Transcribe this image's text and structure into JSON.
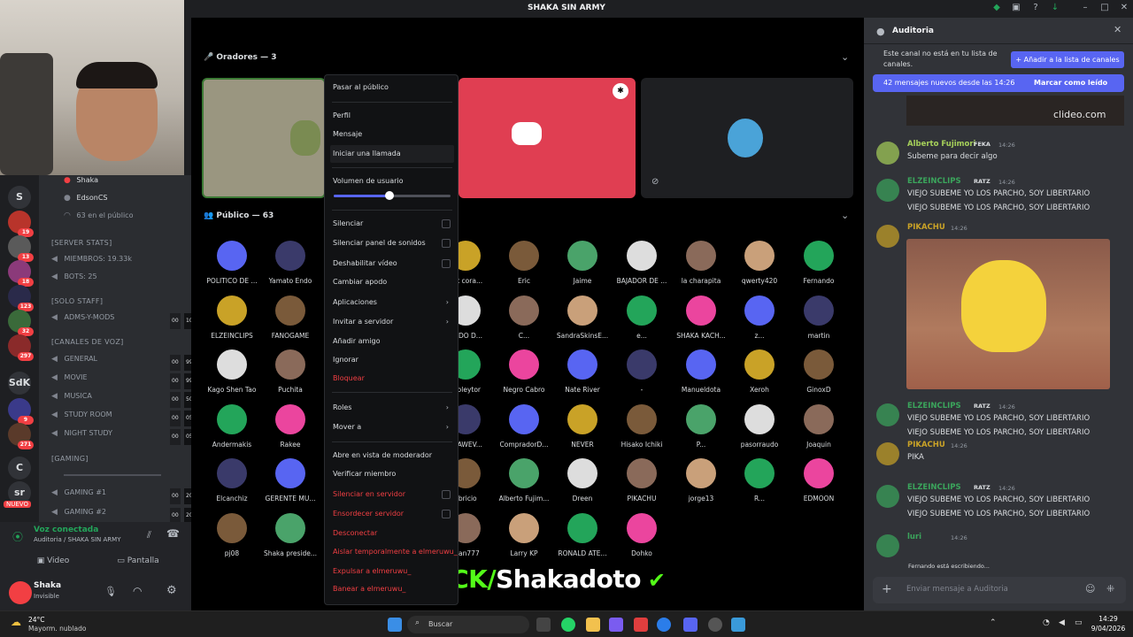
{
  "window": {
    "title": "SHAKA SIN ARMY"
  },
  "servers": [
    {
      "label": "S",
      "badge": ""
    },
    {
      "label": "",
      "badge": "19"
    },
    {
      "label": "",
      "badge": "13"
    },
    {
      "label": "",
      "badge": "18"
    },
    {
      "label": "",
      "badge": "123"
    },
    {
      "label": "",
      "badge": "32"
    },
    {
      "label": "",
      "badge": "297"
    },
    {
      "label": "SdK",
      "badge": ""
    },
    {
      "label": "",
      "badge": "9"
    },
    {
      "label": "",
      "badge": "271"
    },
    {
      "label": "C",
      "badge": ""
    },
    {
      "label": "sr",
      "badge": ""
    }
  ],
  "servers_new_badge": "NUEVO",
  "channels": {
    "voice_users": [
      "Shaka",
      "EdsonCS"
    ],
    "public_count": "63 en el público",
    "server_stats_header": "[SERVER STATS]",
    "members": "MIEMBROS: 19.33k",
    "bots": "BOTS: 25",
    "solo_staff": "[SOLO STAFF]",
    "adms": "ADMS-Y-MODS",
    "adms_c1": "00",
    "adms_c2": "10",
    "voice_header": "[CANALES DE VOZ]",
    "general": "GENERAL",
    "general_c1": "00",
    "general_c2": "99",
    "movie": "MOVIE",
    "movie_c1": "00",
    "movie_c2": "99",
    "musica": "MUSICA",
    "musica_c1": "00",
    "musica_c2": "50",
    "study": "STUDY ROOM",
    "study_c1": "00",
    "study_c2": "05",
    "night": "NIGHT STUDY",
    "night_c1": "00",
    "night_c2": "05",
    "gaming_header": "[GAMING]",
    "gaming1": "GAMING #1",
    "gaming1_c1": "00",
    "gaming1_c2": "20",
    "gaming2": "GAMING #2",
    "gaming2_c1": "00",
    "gaming2_c2": "20"
  },
  "voice_panel": {
    "status": "Voz conectada",
    "location": "Auditoria / SHAKA SIN ARMY",
    "video": "Video",
    "screen": "Pantalla"
  },
  "user_panel": {
    "name": "Shaka",
    "status": "Invisible"
  },
  "stage": {
    "speakers_header": "Oradores — 3",
    "audience_header": "Público — 63"
  },
  "audience": [
    [
      "POLITICO DE ...",
      "Yamato Endo",
      "",
      "ont cora...",
      "Eric",
      "Jaime",
      "BAJADOR DE ...",
      "la charapita",
      "qwerty420",
      "Fernando"
    ],
    [
      "ELZEINCLIPS",
      "FANOGAME",
      "",
      "GADO D...",
      "C...",
      "SandraSkinsE...",
      "e...",
      "SHAKA KACH...",
      "z...",
      "martin"
    ],
    [
      "Kago Shen Tao",
      "Puchita",
      "",
      "rgoleytor",
      "Negro Cabro",
      "Nate River",
      "-",
      "Manueldota",
      "Xeroh",
      "GinoxD"
    ],
    [
      "Andermakis",
      "Rakee",
      "",
      "ESAWEV...",
      "CompradorD...",
      "NEVER",
      "Hisako Ichiki",
      "P...",
      "pasorraudo",
      "Joaquin"
    ],
    [
      "Elcanchiz",
      "GERENTE MU...",
      "",
      "abricio",
      "Alberto Fujim...",
      "Dreen",
      "PIKACHU",
      "jorge13",
      "R...",
      "EDMOON"
    ],
    [
      "pj08",
      "Shaka preside...",
      "",
      "lfran777",
      "Larry KP",
      "RONALD ATE...",
      "Dohko",
      "",
      "",
      ""
    ]
  ],
  "overlay": {
    "kick_prefix": "KICK/",
    "kick_name": "Shakadoto"
  },
  "context_menu": {
    "items": [
      "Pasar al público",
      "Perfil",
      "Mensaje",
      "Iniciar una llamada",
      "Volumen de usuario",
      "Silenciar",
      "Silenciar panel de sonidos",
      "Deshabilitar vídeo",
      "Cambiar apodo",
      "Aplicaciones",
      "Invitar a servidor",
      "Añadir amigo",
      "Ignorar",
      "Bloquear",
      "Roles",
      "Mover a",
      "Abre en vista de moderador",
      "Verificar miembro",
      "Silenciar en servidor",
      "Ensordecer servidor",
      "Desconectar",
      "Aislar temporalmente a elmeruwu_",
      "Expulsar a elmeruwu_",
      "Banear a elmeruwu_"
    ],
    "volume_level": 0.48
  },
  "chat": {
    "title": "Auditoria",
    "not_in_list": "Este canal no está en tu lista de canales.",
    "add_button": "Añadir a la lista de canales",
    "new_msgs": "42 mensajes nuevos desde las 14:26",
    "mark_read": "Marcar como leído",
    "watermark": "clideo.com",
    "messages": [
      {
        "name": "Alberto Fujimori",
        "tag": "FEKA",
        "time": "14:26",
        "lines": [
          "Subeme para decir algo"
        ],
        "color": "#a6d05a"
      },
      {
        "name": "ELZEINCLIPS",
        "tag": "RATZ",
        "time": "14:26",
        "lines": [
          "VIEJO SUBEME YO LOS PARCHO, SOY LIBERTARIO",
          "VIEJO SUBEME YO LOS PARCHO, SOY LIBERTARIO"
        ],
        "color": "#3ba55c"
      },
      {
        "name": "PIKACHU",
        "tag": "",
        "time": "14:26",
        "lines": [],
        "color": "#c9a227"
      },
      {
        "name": "ELZEINCLIPS",
        "tag": "RATZ",
        "time": "14:26",
        "lines": [
          "VIEJO SUBEME YO LOS PARCHO, SOY LIBERTARIO",
          "VIEJO SUBEME YO LOS PARCHO, SOY LIBERTARIO"
        ],
        "color": "#3ba55c"
      },
      {
        "name": "PIKACHU",
        "tag": "",
        "time": "14:26",
        "lines": [
          "PIKA"
        ],
        "color": "#c9a227"
      },
      {
        "name": "ELZEINCLIPS",
        "tag": "RATZ",
        "time": "14:26",
        "lines": [
          "VIEJO SUBEME YO LOS PARCHO, SOY LIBERTARIO",
          "VIEJO SUBEME YO LOS PARCHO, SOY LIBERTARIO"
        ],
        "color": "#3ba55c"
      },
      {
        "name": "luri",
        "tag": "",
        "time": "14:26",
        "lines": [],
        "color": "#3ba55c"
      }
    ],
    "typing": "Fernando está escribiendo...",
    "input_placeholder": "Enviar mensaje a Auditoria"
  },
  "taskbar": {
    "weather_temp": "24°C",
    "weather_desc": "Mayorm. nublado",
    "search": "Buscar",
    "time": "14:29",
    "date": "9/04/2026"
  }
}
